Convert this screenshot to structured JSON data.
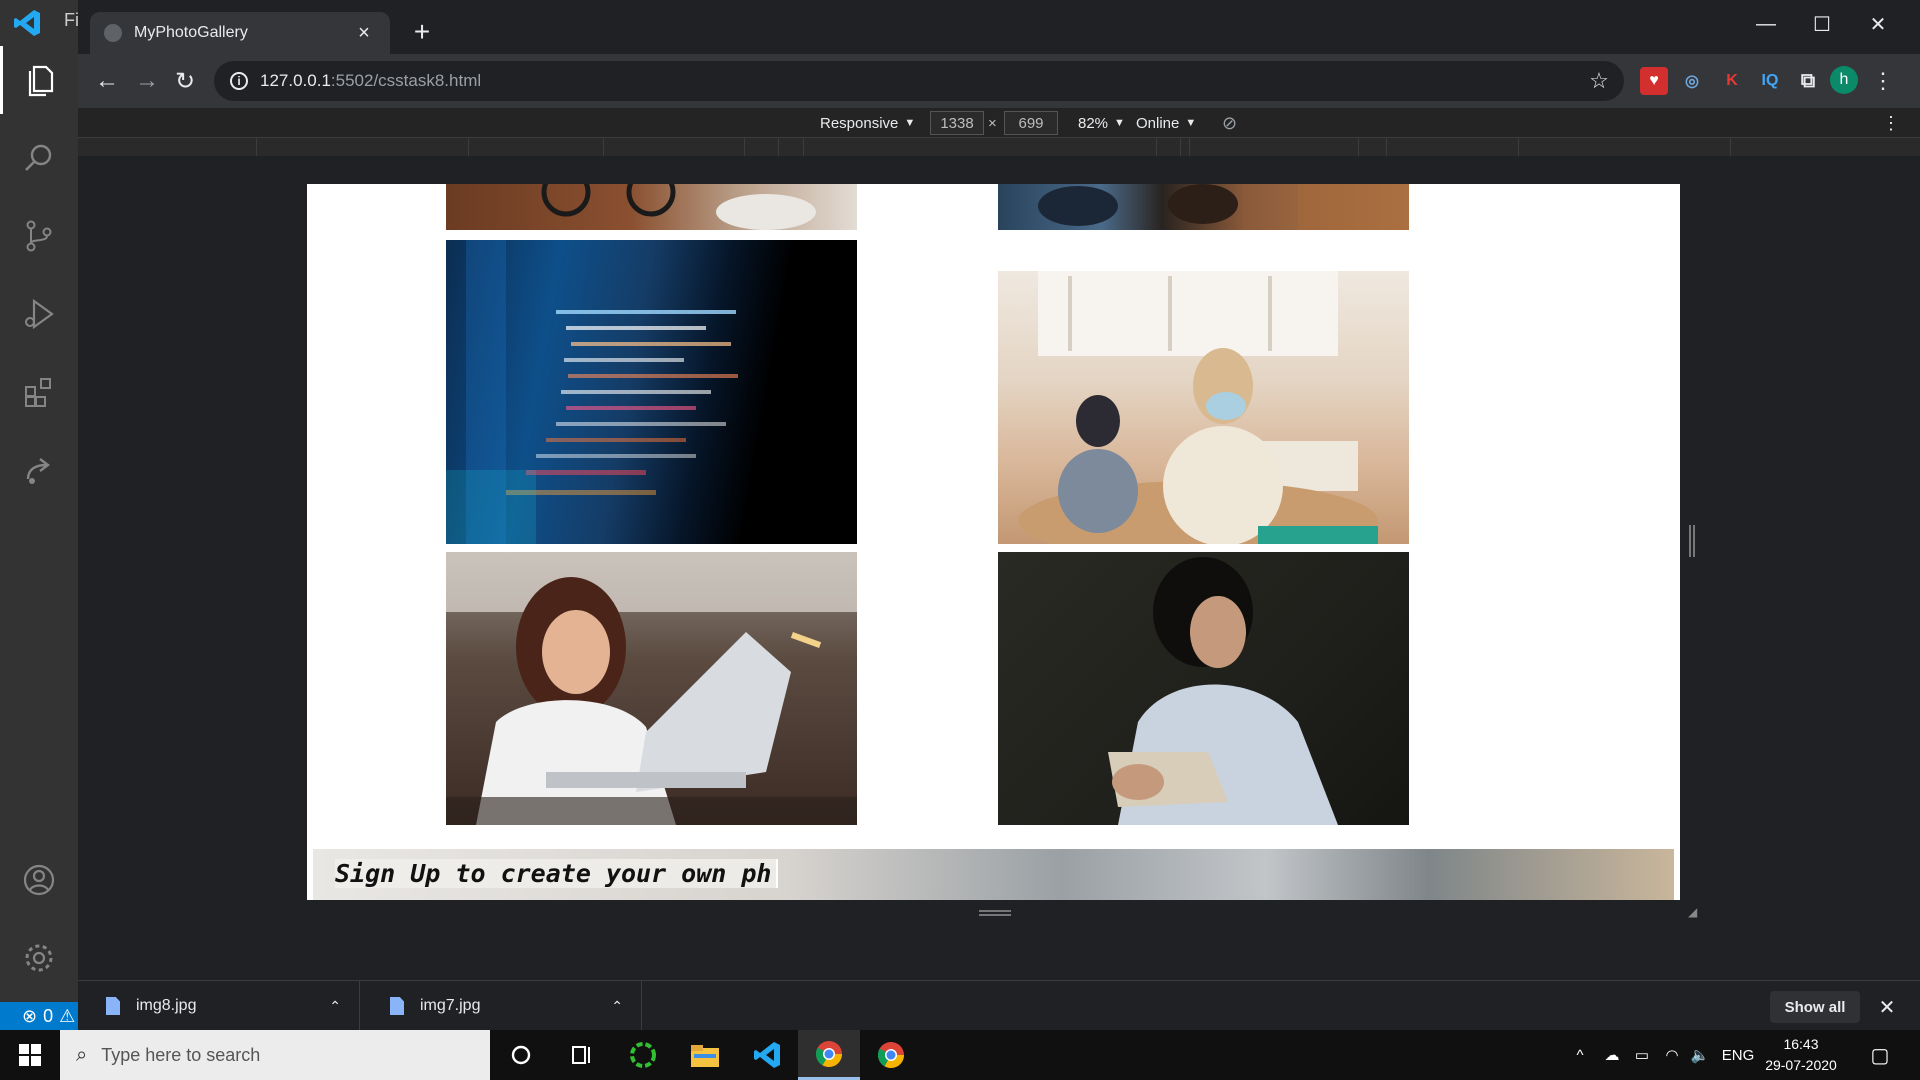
{
  "vscode": {
    "title_fragment": "Fi",
    "status_errors": "0"
  },
  "browser": {
    "tab_title": "MyPhotoGallery",
    "url_host": "127.0.0.1",
    "url_path": ":5502/csstask8.html",
    "profile_initial": "h",
    "ext_k": "K",
    "ext_iq": "IQ"
  },
  "device_toolbar": {
    "mode": "Responsive",
    "width": "1338",
    "times": "×",
    "height": "699",
    "zoom": "82%",
    "network": "Online"
  },
  "page": {
    "signup_text": "Sign Up to create your own ph"
  },
  "downloads": {
    "items": [
      {
        "name": "img8.jpg"
      },
      {
        "name": "img7.jpg"
      }
    ],
    "show_all": "Show all"
  },
  "taskbar": {
    "search_placeholder": "Type here to search",
    "language": "ENG",
    "time": "16:43",
    "date": "29-07-2020"
  },
  "colors": {
    "accent": "#007acc",
    "chrome_bg": "#202124",
    "toolbar_bg": "#35363a"
  }
}
